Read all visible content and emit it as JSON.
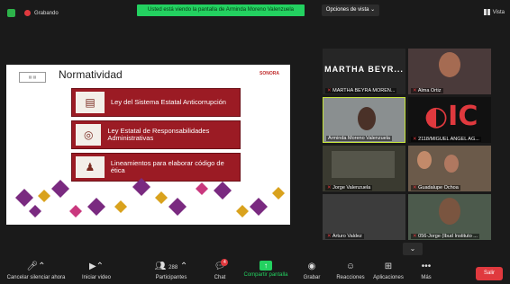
{
  "topbar": {
    "recording": "Grabando",
    "banner": "Usted está viendo la pantalla de Arminda Moreno Valenzuela",
    "view_options": "Opciones de vista ⌄",
    "vista": "Vista"
  },
  "slide": {
    "title": "Normatividad",
    "brand": "SONORA",
    "items": [
      "Ley del Sistema Estatal Anticorrupción",
      "Ley Estatal de Responsabilidades Administrativas",
      "Lineamientos para elaborar código de ética"
    ]
  },
  "participants": [
    {
      "name": "MARTHA BEYRA MOREN...",
      "display": "MARTHA BEYR..."
    },
    {
      "name": "Alma Ortiz"
    },
    {
      "name": "Arminda Moreno Valenzuela"
    },
    {
      "name": "2118/MIGUEL ANGEL AG..."
    },
    {
      "name": "Jorge Valenzuela"
    },
    {
      "name": "Guadalupe Ochoa"
    },
    {
      "name": "Arturo Valdez"
    },
    {
      "name": "056-Jorge (Ibud Instituto ..."
    }
  ],
  "controls": {
    "mute": "Cancelar silenciar ahora",
    "video": "Iniciar video",
    "participants": "Participantes",
    "participants_count": "288",
    "chat": "Chat",
    "chat_badge": "4",
    "share": "Compartir pantalla",
    "record": "Grabar",
    "reactions": "Reacciones",
    "apps": "Aplicaciones",
    "more": "Más",
    "leave": "Salir"
  },
  "colors": {
    "accent": "#23d160",
    "danger": "#e0393e",
    "slide_box": "#9b1b24"
  }
}
